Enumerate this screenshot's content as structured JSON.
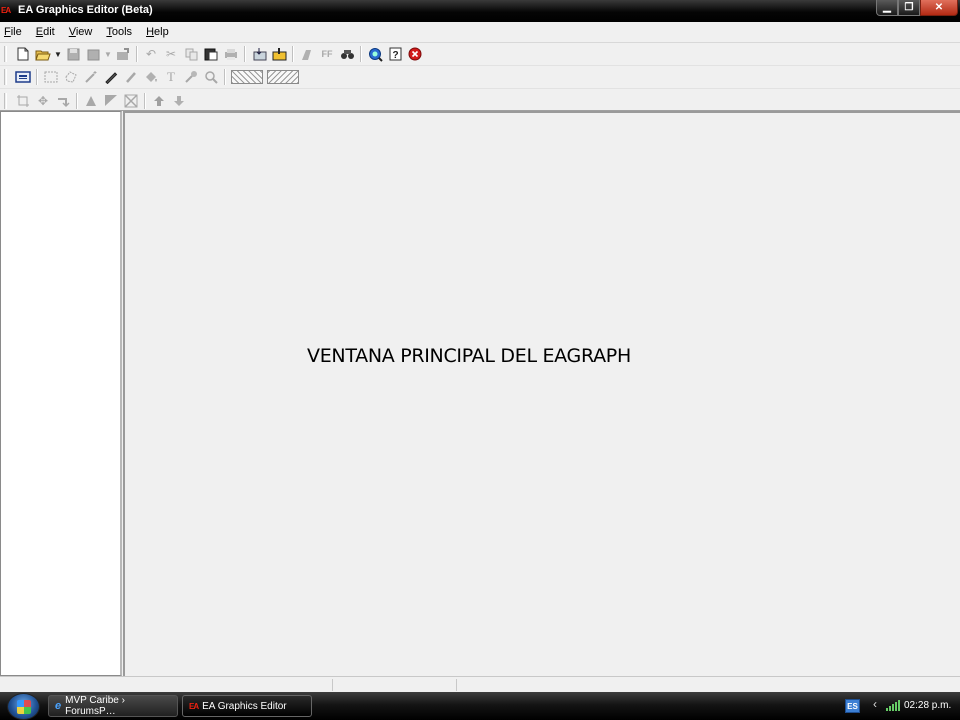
{
  "window": {
    "title": "EA Graphics Editor (Beta)",
    "app_icon": "EA",
    "controls": {
      "minimize": "▁",
      "maximize": "❐",
      "close": "✕"
    }
  },
  "menu": [
    {
      "accel": "F",
      "rest": "ile"
    },
    {
      "accel": "E",
      "rest": "dit"
    },
    {
      "accel": "V",
      "rest": "iew"
    },
    {
      "accel": "T",
      "rest": "ools"
    },
    {
      "accel": "H",
      "rest": "elp"
    }
  ],
  "toolbar_icons": {
    "row1": [
      "new-file-icon",
      "open-folder-icon",
      "dropdown-arrow-icon",
      "save-icon",
      "save-all-icon",
      "dropdown-arrow-icon",
      "export-icon",
      "undo-icon",
      "cut-icon",
      "copy-icon",
      "paste-icon",
      "print-icon",
      "import-icon",
      "import-folder-icon",
      "font-icon",
      "ff-icon",
      "find-icon",
      "zoom-globe-icon",
      "help-icon",
      "exit-icon"
    ],
    "row2": [
      "palette-icon",
      "rect-select-icon",
      "lasso-icon",
      "magic-wand-icon",
      "pencil-icon",
      "brush-icon",
      "fill-icon",
      "text-icon",
      "color-picker-icon",
      "zoom-icon"
    ],
    "row3": [
      "crop-icon",
      "move-icon",
      "rotate-icon",
      "flip-icon",
      "gradient-icon",
      "resize-icon",
      "move-up-icon",
      "move-down-icon"
    ]
  },
  "toolbar_glyphs": {
    "ff": "FF",
    "text": "T"
  },
  "canvas": {
    "caption": "VENTANA PRINCIPAL DEL EAGRAPH"
  },
  "taskbar": {
    "tasks": [
      {
        "label": "MVP Caribe › ForumsP…",
        "icon": "ie-icon"
      },
      {
        "label": "EA Graphics Editor",
        "icon": "ea-icon"
      }
    ],
    "tray": {
      "language": "ES",
      "chevron": "‹",
      "clock": "02:28 p.m."
    }
  }
}
